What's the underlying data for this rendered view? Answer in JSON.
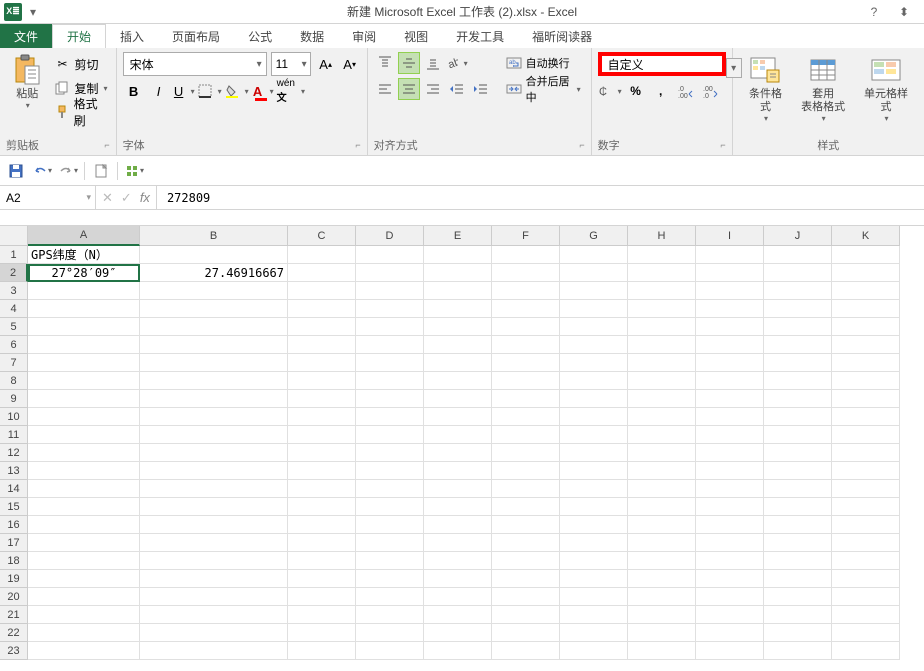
{
  "title": "新建 Microsoft Excel 工作表 (2).xlsx - Excel",
  "tabs": {
    "file": "文件",
    "home": "开始",
    "insert": "插入",
    "pagelayout": "页面布局",
    "formulas": "公式",
    "data": "数据",
    "review": "审阅",
    "view": "视图",
    "developer": "开发工具",
    "foxit": "福昕阅读器"
  },
  "clipboard": {
    "paste": "粘贴",
    "cut": "剪切",
    "copy": "复制",
    "painter": "格式刷",
    "group": "剪贴板"
  },
  "font": {
    "name": "宋体",
    "size": "11",
    "group": "字体"
  },
  "alignment": {
    "wrap": "自动换行",
    "merge": "合并后居中",
    "group": "对齐方式"
  },
  "number": {
    "format": "自定义",
    "group": "数字"
  },
  "styles": {
    "conditional": "条件格式",
    "table": "套用\n表格格式",
    "cell": "单元格样式",
    "group": "样式"
  },
  "namebox": "A2",
  "formula": "272809",
  "columns": [
    "A",
    "B",
    "C",
    "D",
    "E",
    "F",
    "G",
    "H",
    "I",
    "J",
    "K"
  ],
  "rows": [
    "1",
    "2",
    "3",
    "4",
    "5",
    "6",
    "7",
    "8",
    "9",
    "10",
    "11",
    "12",
    "13",
    "14",
    "15",
    "16",
    "17",
    "18",
    "19",
    "20",
    "21",
    "22",
    "23"
  ],
  "cells": {
    "A1": "GPS纬度（N）",
    "A2": "27°28′09″",
    "B2": "27.46916667"
  },
  "chart_data": null
}
